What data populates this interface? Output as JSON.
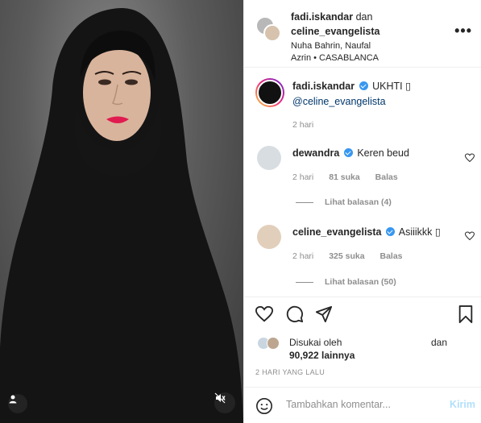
{
  "header": {
    "user1": "fadi.iskandar",
    "conjunction": "dan",
    "user2": "celine_evangelista",
    "location_line1": "Nuha Bahrin, Naufal",
    "location_line2": "Azrin • CASABLANCA"
  },
  "caption": {
    "username": "fadi.iskandar",
    "text": "UKHTI ▯",
    "mention": "@celine_evangelista",
    "time": "2 hari"
  },
  "comments": [
    {
      "username": "dewandra",
      "text": "Keren beud",
      "time": "2 hari",
      "likes": "81 suka",
      "reply_label": "Balas",
      "view_replies": "Lihat balasan (4)"
    },
    {
      "username": "celine_evangelista",
      "text": "Asiiikkk ▯",
      "time": "2 hari",
      "likes": "325 suka",
      "reply_label": "Balas",
      "view_replies": "Lihat balasan (50)"
    }
  ],
  "likes": {
    "label": "Disukai oleh",
    "and": "dan",
    "count": "90,922 lainnya"
  },
  "posted_ago": "2 HARI YANG LALU",
  "composer": {
    "placeholder": "Tambahkan komentar...",
    "send_label": "Kirim"
  },
  "icons": {
    "like": "heart-icon",
    "comment": "comment-icon",
    "share": "share-icon",
    "save": "bookmark-icon",
    "emoji": "emoji-icon",
    "more": "more-icon",
    "tag": "user-tag-icon",
    "mute": "mute-icon"
  },
  "colors": {
    "verified": "#3897f0",
    "link": "#00376b",
    "secondary_text": "#8e8e8e",
    "send_disabled": "#b2dffc"
  }
}
